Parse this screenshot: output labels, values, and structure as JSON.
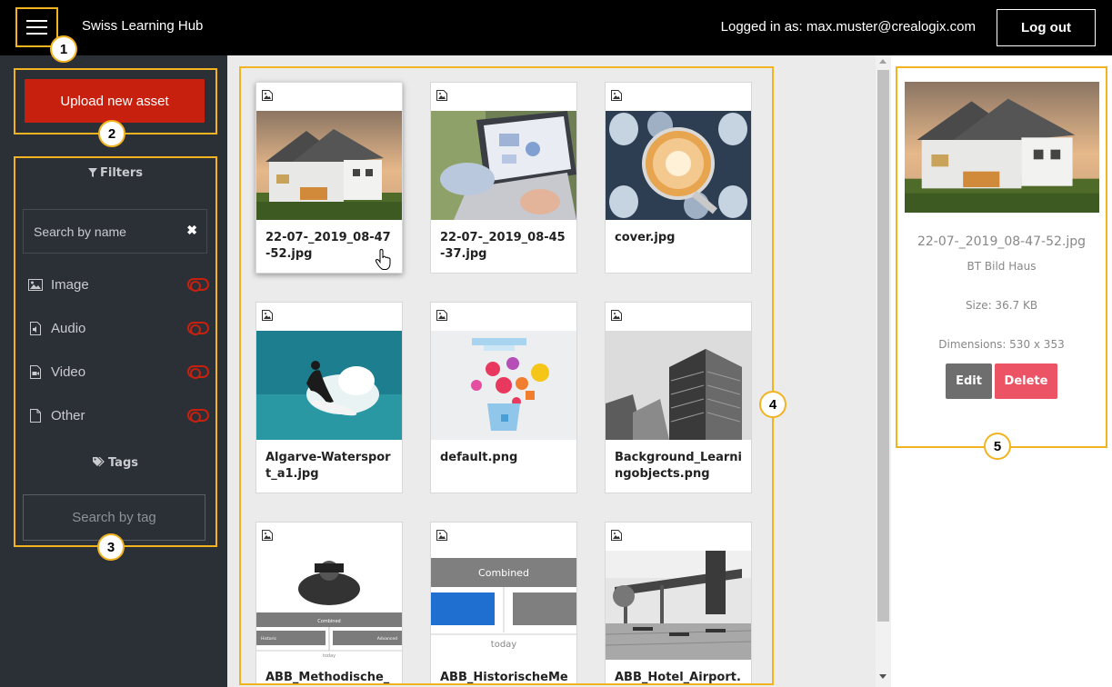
{
  "header": {
    "app_title": "Swiss Learning Hub",
    "logged_in_text": "Logged in as: max.muster@crealogix.com",
    "logout_label": "Log out"
  },
  "callouts": [
    "1",
    "2",
    "3",
    "4",
    "5"
  ],
  "sidebar": {
    "upload_label": "Upload new asset",
    "filters_title": "Filters",
    "search_name_placeholder": "Search by name",
    "clear_icon": "✖",
    "filters": [
      {
        "label": "Image",
        "icon": "image-icon",
        "enabled": false
      },
      {
        "label": "Audio",
        "icon": "audio-file-icon",
        "enabled": false
      },
      {
        "label": "Video",
        "icon": "video-file-icon",
        "enabled": false
      },
      {
        "label": "Other",
        "icon": "file-icon",
        "enabled": false
      }
    ],
    "tags_title": "Tags",
    "search_tag_placeholder": "Search by tag"
  },
  "assets": [
    {
      "name": "22-07-_2019_08-47-52.jpg",
      "thumb": "house",
      "selected": true
    },
    {
      "name": "22-07-_2019_08-45-37.jpg",
      "thumb": "laptop",
      "selected": false
    },
    {
      "name": "cover.jpg",
      "thumb": "brain",
      "selected": false
    },
    {
      "name": "Algarve-Watersport_a1.jpg",
      "thumb": "surf",
      "selected": false
    },
    {
      "name": "default.png",
      "thumb": "default",
      "selected": false
    },
    {
      "name": "Background_Learningobjects.png",
      "thumb": "building",
      "selected": false
    },
    {
      "name": "ABB_Methodische_Un",
      "thumb": "binoculars",
      "selected": false
    },
    {
      "name": "ABB_HistorischeMeth",
      "thumb": "combined",
      "selected": false
    },
    {
      "name": "ABB_Hotel_Airport.pn",
      "thumb": "airport",
      "selected": false
    }
  ],
  "thumb_text": {
    "combined": "Combined",
    "today": "today",
    "historic": "Historic",
    "advanced": "Advanced"
  },
  "detail": {
    "name": "22-07-_2019_08-47-52.jpg",
    "alt": "BT Bild Haus",
    "size": "Size: 36.7 KB",
    "dimensions": "Dimensions: 530 x 353",
    "edit_label": "Edit",
    "delete_label": "Delete"
  },
  "colors": {
    "highlight": "#f2b320",
    "upload": "#c8200f",
    "delete": "#ec5364",
    "edit": "#6e6e6e"
  }
}
